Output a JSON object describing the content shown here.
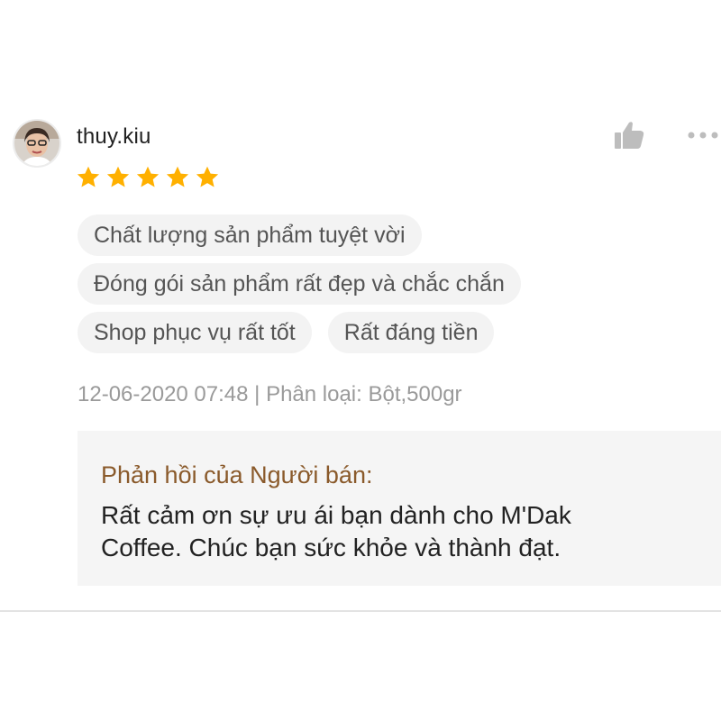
{
  "review": {
    "username": "thuy.kiu",
    "rating": 5,
    "rating_max": 5,
    "tags": [
      [
        "Chất lượng sản phẩm tuyệt vời"
      ],
      [
        "Đóng gói sản phẩm rất đẹp và chắc chắn"
      ],
      [
        "Shop phục vụ rất tốt",
        "Rất đáng tiền"
      ]
    ],
    "meta": "12-06-2020 07:48 | Phân loại: Bột,500gr",
    "seller_reply": {
      "title": "Phản hồi của Người bán:",
      "text": "Rất cảm ơn sự ưu ái bạn dành cho M'Dak Coffee. Chúc bạn sức khỏe và thành đạt."
    }
  },
  "icons": {
    "like": "thumbs-up-icon",
    "more": "more-dots-icon",
    "star": "star-icon"
  },
  "colors": {
    "star": "#FFB000",
    "reply_title": "#8A5A2B",
    "tag_bg": "#F3F3F3",
    "reply_bg": "#F5F5F5",
    "meta": "#9A9A9A",
    "icon": "#BDBDBD"
  }
}
